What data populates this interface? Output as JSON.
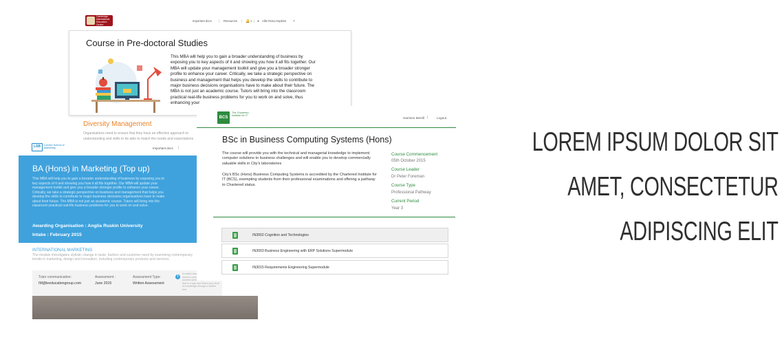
{
  "headline": {
    "line1": "LOREM IPSUM DOLOR SIT",
    "line2": "AMET, CONSECTETUR",
    "line3": "ADIPISCING ELIT"
  },
  "cambridge": {
    "logo_text": "Cambridge International Education Centre",
    "nav": {
      "important_docs": "Important docs",
      "resources": "Resources",
      "bell_count": "1",
      "user": "Allie Rosa Hopkins"
    },
    "title": "Course in Pre-doctoral Studies",
    "body": "This MBA will help you to gain a broader understanding of business by exposing you to key aspects of it and showing you how it all fits together. Our MBA will update your management toolkit and give you a broader stronger profile to enhance your career. Critically, we take a strategic perspective on business and management that helps you develop the skills to contribute to major business decisions organisations have to make about their future. The MBA is not just an academic course. Tutors will bring into the classroom practical real-life business problems for you to work on and solve, thus enhancing your",
    "section": "Diversity Management",
    "section_text": "Organisations need to ensure that they have an effective approach to understanding and skills to be able to match the needs and expectations"
  },
  "lsbm": {
    "logo_short": "LSB",
    "logo_text": "London School of Marketing",
    "important_docs": "Important docs",
    "title": "BA (Hons) in Marketing (Top up)",
    "body": "This MBA will help you to gain a broader understanding of business by exposing you to key aspects of it and showing you how it all fits together. Our MBA will update your management toolkit and give you a broader stronger profile to enhance your career. Critically, we take a strategic perspective on business and management that helps you develop the skills to contribute to major business decisions organisations have to make about their future. The MBA is not just an academic course. Tutors will bring into the classroom practical real-life business problems for you to work on and solve.",
    "awarding": "Awarding Organisation : Anglia Ruskin University",
    "intake": "Intake : February 2015",
    "section": "INTERNATIONAL MARKETING",
    "section_text": "The module investigates stylistic change in taste, fashion and customer need by examining contemporary trends in marketing, design and innovation, including contemporary products and services.",
    "details": {
      "tutor_label": "Tutor communication:",
      "tutor_value": "IM@leeducationgroup.com",
      "assessment_label": "Assessment :",
      "assessment_value": "June 2015",
      "type_label": "Assessment Type:",
      "type_value": "Written Assessment",
      "note": "A written assessment is where you need to cover all theories and practice pertaining to the module that is a way that reflect your level of knowledge through a written test."
    }
  },
  "bcs": {
    "logo_short": "BCS",
    "logo_text": "The Chartered Institute for IT",
    "nav": {
      "user": "Harrison Merrill",
      "logout": "Logout"
    },
    "title": "BSc in Business Computing Systems (Hons)",
    "desc1": "The course will provide you with the technical and managerial knowledge to implement computer solutions to business challenges and will enable you to develop commercially valuable skills in City's laboratories",
    "desc2": "City's BSc (Hons) Business Computing Systems is accredited by the Chartered Institute for IT (BCS), exempting students from their professional examinations and offering a pathway to Chartered status.",
    "meta": [
      {
        "label": "Course Commencement",
        "value": "05th October 2015"
      },
      {
        "label": "Course Leader",
        "value": "Dr Peter Foreman"
      },
      {
        "label": "Course Type",
        "value": "Professional Pathway"
      },
      {
        "label": "Current Period",
        "value": "Year 3"
      }
    ],
    "modules": [
      {
        "label": "IN3002  Cognition and Technologies"
      },
      {
        "label": "IN3003 Business Engineering with ERP Solutions Supermodule"
      },
      {
        "label": "IN3015 Requirements Engineering Supermodule"
      }
    ]
  },
  "colors": {
    "bcs_green": "#2e8b3f",
    "lsbm_blue": "#3fa2dd",
    "cambridge_red": "#a0141c",
    "diversity_orange": "#e8842c"
  }
}
